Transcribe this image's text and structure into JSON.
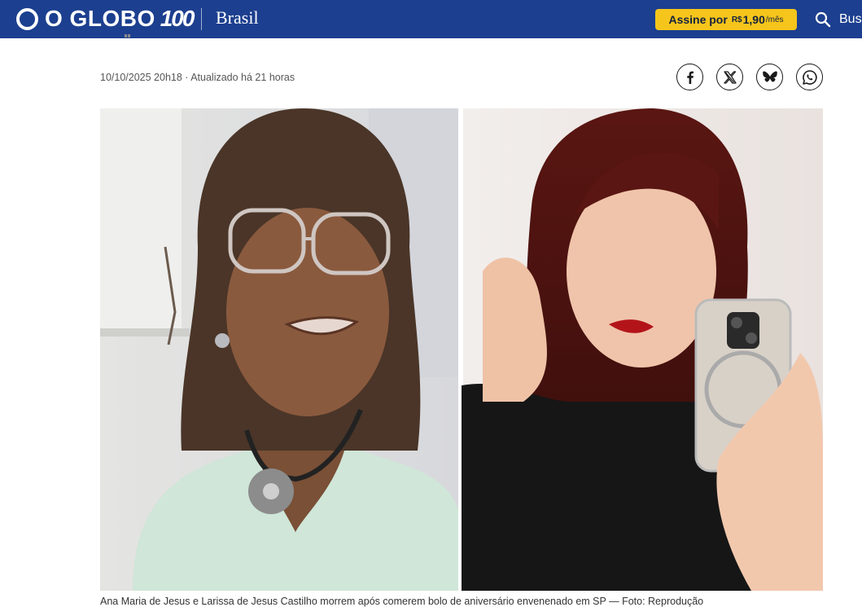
{
  "header": {
    "brand": "O GLOBO",
    "anniversary": "100",
    "section": "Brasil",
    "subscribe": {
      "label": "Assine por",
      "currency": "R$",
      "price": "1,90",
      "period": "/mês"
    },
    "search_label": "Bus"
  },
  "article": {
    "timestamp": "10/10/2025 20h18 · Atualizado há 21 horas",
    "share": [
      {
        "network": "Facebook",
        "icon": "facebook-icon"
      },
      {
        "network": "X",
        "icon": "x-icon"
      },
      {
        "network": "Bluesky",
        "icon": "bluesky-icon"
      },
      {
        "network": "WhatsApp",
        "icon": "whatsapp-icon"
      }
    ],
    "caption": "Ana Maria de Jesus e Larissa de Jesus Castilho morrem após comerem bolo de aniversário envenenado em SP — Foto: Reprodução"
  },
  "colors": {
    "header_bg": "#1c3f8f",
    "subscribe_bg": "#f6c51b"
  }
}
